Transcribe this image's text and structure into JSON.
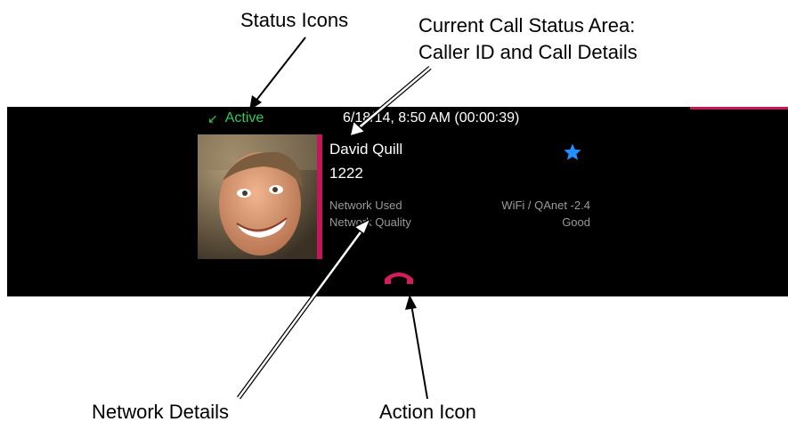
{
  "callouts": {
    "status_icons": "Status Icons",
    "call_status_line1": "Current Call Status Area:",
    "call_status_line2": "Caller ID and Call Details",
    "network_details": "Network Details",
    "action_icon": "Action Icon"
  },
  "call": {
    "status": "Active",
    "status_icon": "arrow-incoming-icon",
    "datetime": "6/18/14, 8:50 AM  (00:00:39)",
    "caller_name": "David Quill",
    "caller_number": "1222",
    "favorite_icon": "star-icon",
    "network": [
      {
        "label": "Network Used",
        "value": "WiFi / QAnet -2.4"
      },
      {
        "label": "Network Quality",
        "value": "Good"
      }
    ],
    "action_icon": "hang-up-icon"
  },
  "colors": {
    "panel_bg": "#000000",
    "status_green": "#2ecc5a",
    "accent_red": "#c2185b",
    "star_blue": "#1e90ff",
    "muted_text": "#9a9a9a"
  }
}
